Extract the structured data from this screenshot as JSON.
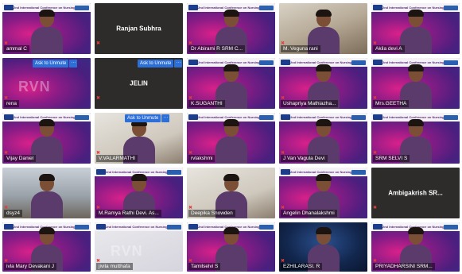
{
  "meeting": {
    "banner_text": "2nd International Conference on Nursing Practice and Healthcare",
    "watermark_text": "RVN",
    "ask_to_unmute": "Ask to Unmute",
    "more": "···",
    "participants": [
      {
        "name": "ammal C",
        "bg": "conf",
        "banner": true,
        "person": true
      },
      {
        "name": "Ranjan Subhra",
        "bg": "dark",
        "center": true
      },
      {
        "name": "Dr Abirami R SRM C...",
        "bg": "conf",
        "banner": true,
        "person": true
      },
      {
        "name": "M. Veguna rani",
        "bg": "photo",
        "person": true
      },
      {
        "name": "Akila devi A",
        "bg": "conf",
        "banner": true,
        "person": true
      },
      {
        "name": "rena",
        "bg": "conf",
        "unmute": true,
        "person": false,
        "watermark": true
      },
      {
        "name": "JELIN",
        "bg": "dark",
        "center": true,
        "unmute": true
      },
      {
        "name": "K.SUGANTHI",
        "bg": "conf",
        "banner": true,
        "person": true
      },
      {
        "name": "Ushapriya Mathiazha...",
        "bg": "conf",
        "banner": true,
        "person": true
      },
      {
        "name": "Mrs.GEETHA",
        "bg": "conf",
        "banner": true,
        "person": true
      },
      {
        "name": "Vijay Daniel",
        "bg": "conf",
        "banner": true,
        "person": true
      },
      {
        "name": "V.VALARMATHI",
        "bg": "room",
        "unmute": true,
        "person": true
      },
      {
        "name": "rvlakshmi",
        "bg": "conf",
        "banner": true,
        "person": true
      },
      {
        "name": "J Van Vagula Devi",
        "bg": "conf",
        "banner": true,
        "person": true
      },
      {
        "name": "SRM SELVI S",
        "bg": "conf",
        "banner": true,
        "person": true
      },
      {
        "name": "dsyz4",
        "bg": "home",
        "person": true
      },
      {
        "name": "M.Ramya Rathi Devi. As...",
        "bg": "conf",
        "banner": true,
        "person": true
      },
      {
        "name": "Deepika Snowden",
        "bg": "room",
        "person": true
      },
      {
        "name": "Angelin Dhanalakshmi",
        "bg": "conf",
        "banner": true,
        "person": true
      },
      {
        "name": "Ambigakrish SR...",
        "bg": "dark",
        "center": true
      },
      {
        "name": "ivla Mary Devakani J",
        "bg": "conf",
        "banner": true,
        "person": true
      },
      {
        "name": "jivila mutthafa",
        "bg": "light",
        "banner": true,
        "watermark": true
      },
      {
        "name": "Tamilselvi S",
        "bg": "conf",
        "banner": true,
        "person": true
      },
      {
        "name": "EZHILARASI. R",
        "bg": "space",
        "person": true
      },
      {
        "name": "PRIYADHARSINI SRM...",
        "bg": "conf",
        "banner": true,
        "person": true
      }
    ]
  }
}
